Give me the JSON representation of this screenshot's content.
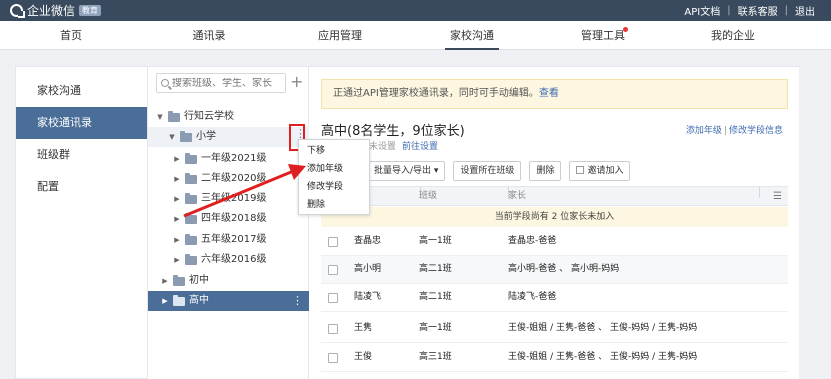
{
  "topbar": {
    "app_name": "企业微信",
    "badge": "教育",
    "links": [
      "API文档",
      "联系客服",
      "退出"
    ]
  },
  "nav": {
    "items": [
      "首页",
      "通讯录",
      "应用管理",
      "家校沟通",
      "管理工具",
      "我的企业"
    ],
    "active": "家校沟通"
  },
  "sidemenu": {
    "items": [
      "家校沟通",
      "家校通讯录",
      "班级群",
      "配置"
    ],
    "active": "家校通讯录"
  },
  "tree": {
    "search_placeholder": "搜索班级、学生、家长",
    "add_symbol": "+",
    "root": "行知云学校",
    "n_primary": "小学",
    "grades": [
      "一年级2021级",
      "二年级2020级",
      "三年级2019级",
      "四年级2018级",
      "五年级2017级",
      "六年级2016级"
    ],
    "n_middle": "初中",
    "n_high": "高中",
    "kebab": "⋮"
  },
  "context_menu": {
    "items": [
      "下移",
      "添加年级",
      "修改学段",
      "删除"
    ]
  },
  "content": {
    "notice_text": "正通过API管理家校通讯录，同时可手动编辑。",
    "notice_link": "查看",
    "heading": "高中(8名学生，9位家长)",
    "link_add_grade": "添加年级",
    "link_sep": "|",
    "link_edit_stage": "修改学段信息",
    "subline_gray": "未设置",
    "subline_link": "前往设置",
    "toolbar": {
      "first": "",
      "import_export": "批量导入/导出 ▾",
      "set_class": "设置所在班级",
      "delete": "删除",
      "invite": "邀请加入"
    },
    "table": {
      "headers": [
        "班级",
        "家长"
      ],
      "col_menu_icon": "☰",
      "banner": "当前学段尚有 2 位家长未加入",
      "rows": [
        {
          "name": "查晶忠",
          "class": "高一1班",
          "parents": "查晶忠-爸爸"
        },
        {
          "name": "高小明",
          "class": "高二1班",
          "parents": "高小明-爸爸 、 高小明-妈妈"
        },
        {
          "name": "陆凌飞",
          "class": "高二1班",
          "parents": "陆凌飞-爸爸"
        },
        {
          "name": "王隽",
          "class": "高一1班",
          "parents": "王俊-姐姐 / 王隽-爸爸 、 王俊-妈妈 / 王隽-妈妈"
        },
        {
          "name": "王俊",
          "class": "高三1班",
          "parents": "王俊-姐姐 / 王隽-爸爸 、 王俊-妈妈 / 王隽-妈妈"
        }
      ]
    }
  },
  "colors": {
    "topbar_bg": "#3a4a5e",
    "accent": "#4a6e98",
    "link": "#3e6bb0",
    "annotation_red": "#e02020",
    "notice_bg": "#fdf6e0"
  }
}
